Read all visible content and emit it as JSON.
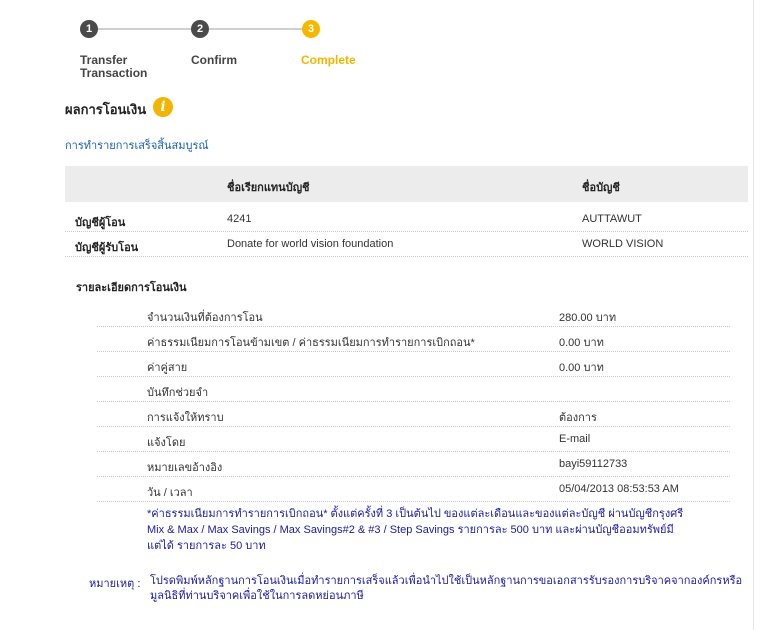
{
  "steps": [
    {
      "number": "1",
      "label": "Transfer Transaction",
      "label_line1": "Transfer",
      "label_line2": "Transaction"
    },
    {
      "number": "2",
      "label": "Confirm"
    },
    {
      "number": "3",
      "label": "Complete"
    }
  ],
  "colors": {
    "active_step": "#f5b800",
    "done_step": "#4a4a4a",
    "link": "#1a5fb4",
    "note": "#1a1aa6",
    "required": "#d40000"
  },
  "page": {
    "title": "ผลการโอนเงิน",
    "info_icon": "info-icon",
    "success_message": "การทำรายการเสร็จสิ้นสมบูรณ์"
  },
  "accounts": {
    "headers": [
      "ชื่อเรียกแทนบัญชี",
      "ชื่อบัญชี"
    ],
    "rows": [
      {
        "label": "บัญชีผู้โอน",
        "nickname": "4241",
        "name": "AUTTAWUT"
      },
      {
        "label": "บัญชีผู้รับโอน",
        "nickname": "Donate for world vision foundation",
        "name": "WORLD VISION"
      }
    ]
  },
  "details": {
    "title": "รายละเอียดการโอนเงิน",
    "rows": [
      {
        "label": "จำนวนเงินที่ต้องการโอน",
        "value": "280.00 บาท"
      },
      {
        "label": "ค่าธรรมเนียมการโอนข้ามเขต / ค่าธรรมเนียมการทำรายการเบิกถอน",
        "marker": "*",
        "value": "0.00 บาท"
      },
      {
        "label": "ค่าคู่สาย",
        "value": "0.00 บาท"
      },
      {
        "label": "บันทึกช่วยจำ",
        "value": ""
      },
      {
        "label": "การแจ้งให้ทราบ",
        "value": "ต้องการ"
      },
      {
        "label": "แจ้งโดย",
        "value": "E-mail"
      },
      {
        "label": "หมายเลขอ้างอิง",
        "value": "bayi59112733"
      },
      {
        "label": "วัน / เวลา",
        "value": "05/04/2013 08:53:53 AM"
      }
    ]
  },
  "fee_note": "*ค่าธรรมเนียมการทำรายการเบิกถอน* ตั้งแต่ครั้งที่ 3 เป็นต้นไป ของแต่ละเดือนและของแต่ละบัญชี ผ่านบัญชีกรุงศรี Mix & Max / Max Savings / Max Savings#2 & #3 / Step Savings รายการละ 500 บาท และผ่านบัญชีออมทรัพย์มีแต่ได้ รายการละ 50 บาท",
  "remark": {
    "label": "หมายเหตุ :",
    "text": "โปรดพิมพ์หลักฐานการโอนเงินเมื่อทำรายการเสร็จแล้วเพื่อนำไปใช้เป็นหลักฐานการขอเอกสารรับรองการบริจาคจากองค์กรหรือมูลนิธิที่ท่านบริจาคเพื่อใช้ในการลดหย่อนภาษี"
  }
}
